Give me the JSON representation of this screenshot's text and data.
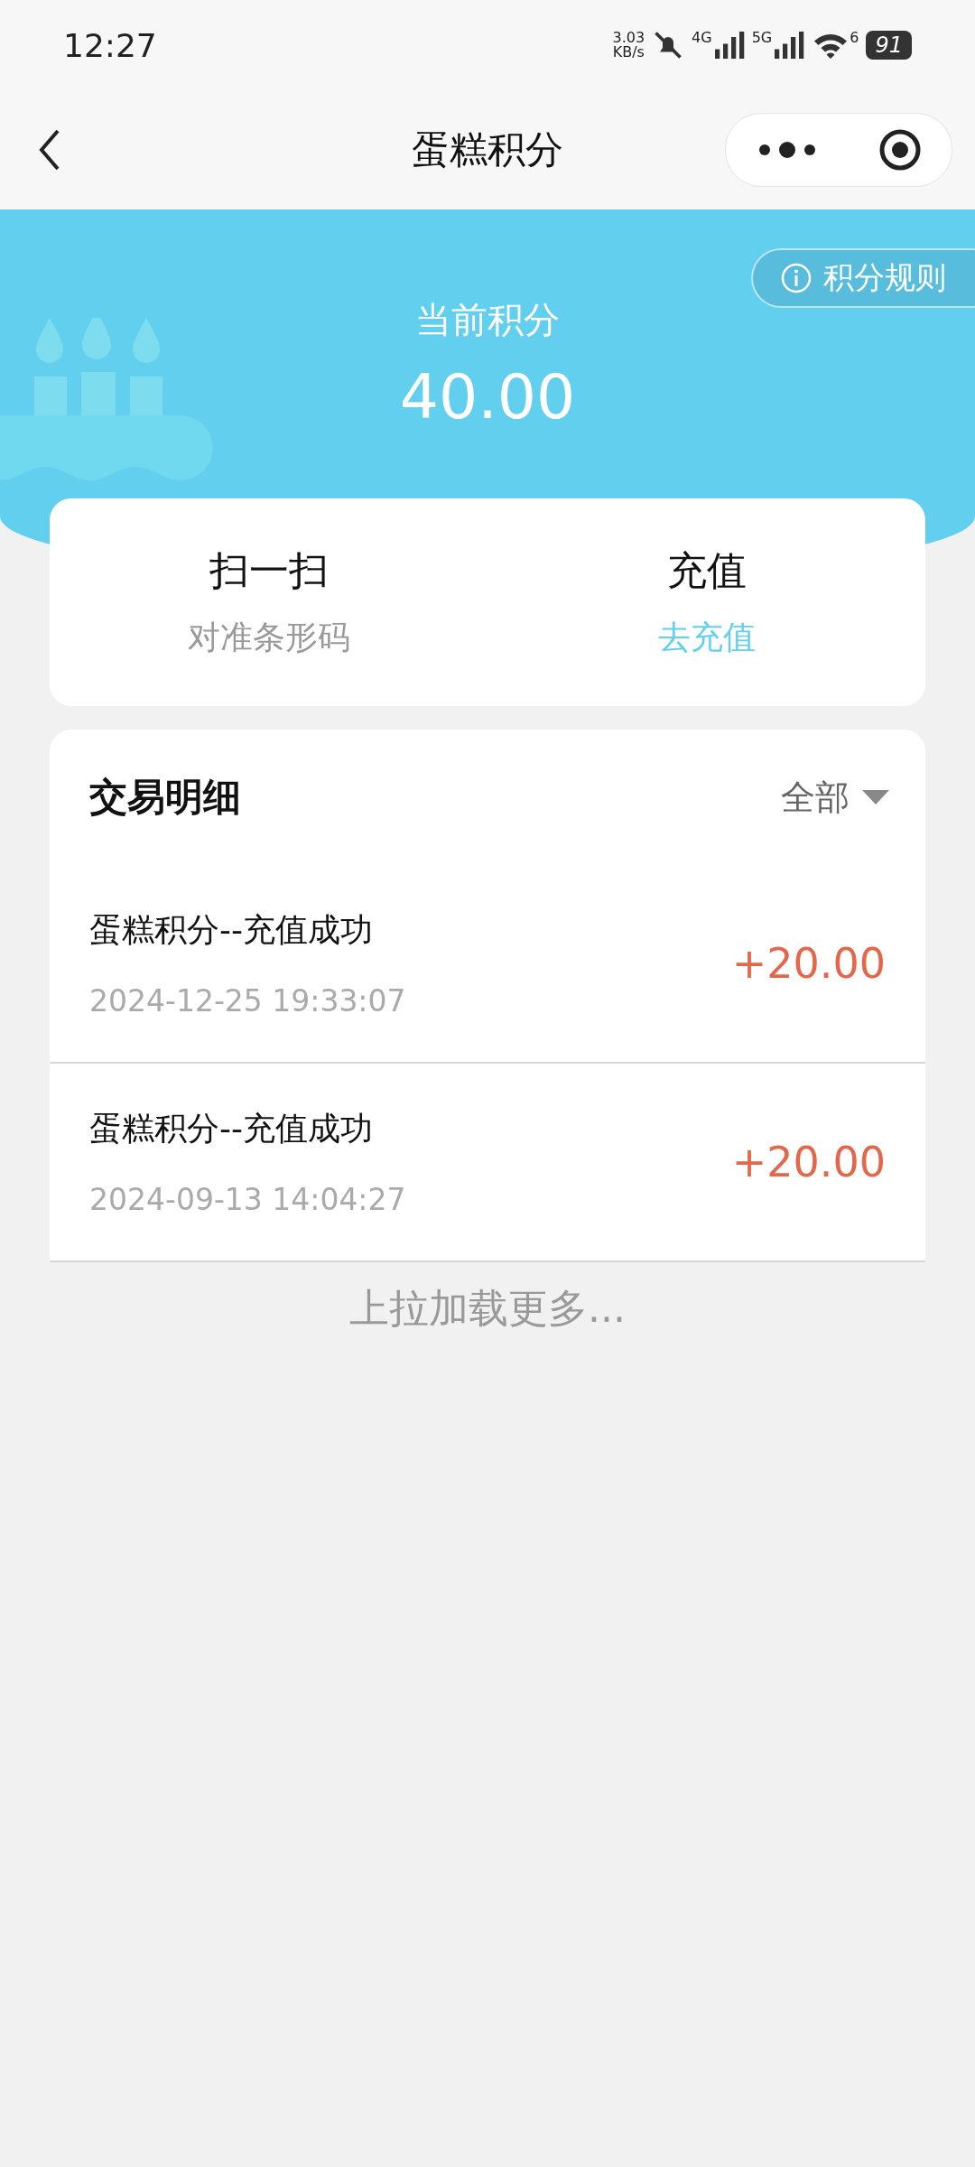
{
  "status_bar": {
    "time": "12:27",
    "net_speed": "3.03",
    "net_unit": "KB/s",
    "sim1": "4G",
    "sim2": "5G",
    "wifi_label": "6",
    "battery": "91"
  },
  "nav": {
    "title": "蛋糕积分"
  },
  "banner": {
    "rules_button": "积分规则",
    "label": "当前积分",
    "points": "40.00"
  },
  "actions": [
    {
      "title": "扫一扫",
      "subtitle": "对准条形码",
      "kind": "hint"
    },
    {
      "title": "充值",
      "subtitle": "去充值",
      "kind": "link"
    }
  ],
  "transactions": {
    "title": "交易明细",
    "filter": "全部",
    "rows": [
      {
        "name": "蛋糕积分--充值成功",
        "time": "2024-12-25 19:33:07",
        "amount": "+20.00"
      },
      {
        "name": "蛋糕积分--充值成功",
        "time": "2024-09-13 14:04:27",
        "amount": "+20.00"
      }
    ]
  },
  "footer": "上拉加载更多..."
}
